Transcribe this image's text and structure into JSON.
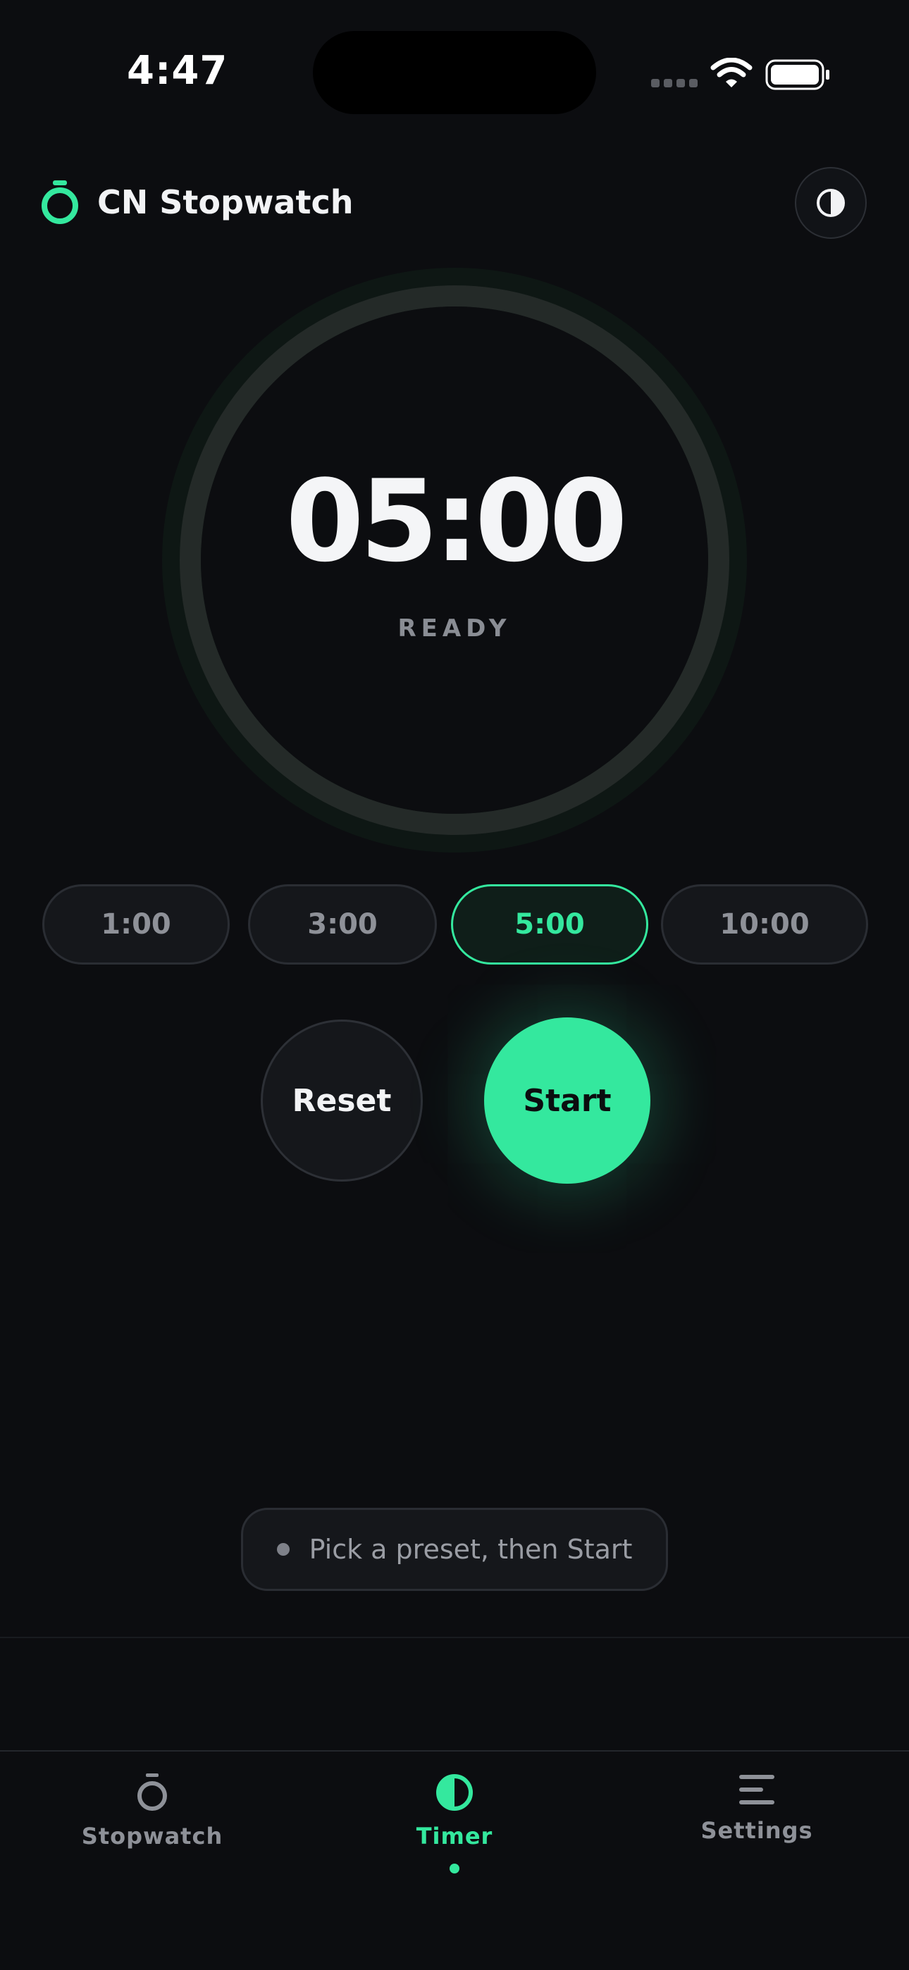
{
  "status_bar": {
    "time": "4:47"
  },
  "header": {
    "title": "CN Stopwatch",
    "theme_toggle_icon": "contrast-icon"
  },
  "timer": {
    "display": "05:00",
    "state": "READY",
    "progress": 0
  },
  "presets": [
    {
      "label": "1:00",
      "selected": false
    },
    {
      "label": "3:00",
      "selected": false
    },
    {
      "label": "5:00",
      "selected": true
    },
    {
      "label": "10:00",
      "selected": false
    }
  ],
  "actions": {
    "reset_label": "Reset",
    "start_label": "Start"
  },
  "hint": {
    "text": "Pick a preset, then Start"
  },
  "tabs": [
    {
      "label": "Stopwatch",
      "icon": "stopwatch-icon",
      "active": false
    },
    {
      "label": "Timer",
      "icon": "timer-icon",
      "active": true
    },
    {
      "label": "Settings",
      "icon": "menu-icon",
      "active": false
    }
  ],
  "colors": {
    "accent": "#34e89e",
    "background": "#0c0d10",
    "surface": "#15171b"
  }
}
